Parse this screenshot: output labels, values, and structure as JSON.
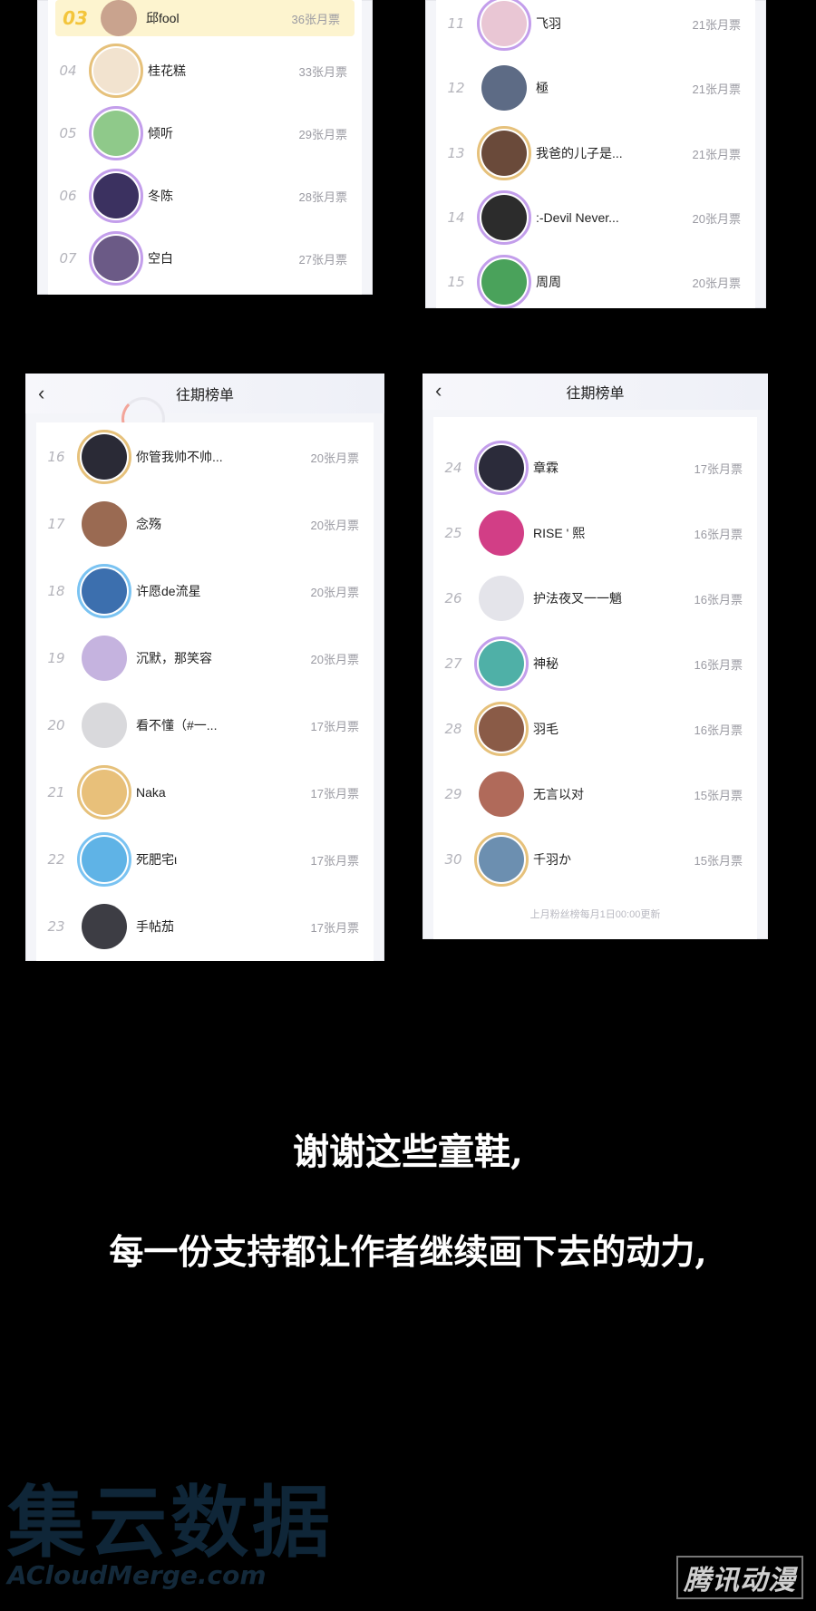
{
  "panels": {
    "top_left": {
      "rows": [
        {
          "rank": "03",
          "name": "邱fool",
          "votes": "36张月票",
          "highlight": true
        },
        {
          "rank": "04",
          "name": "桂花糕",
          "votes": "33张月票"
        },
        {
          "rank": "05",
          "name": "倾听",
          "votes": "29张月票"
        },
        {
          "rank": "06",
          "name": "冬陈",
          "votes": "28张月票"
        },
        {
          "rank": "07",
          "name": "空白",
          "votes": "27张月票"
        }
      ]
    },
    "top_right": {
      "rows": [
        {
          "rank": "11",
          "name": "飞羽",
          "votes": "21张月票"
        },
        {
          "rank": "12",
          "name": "極",
          "votes": "21张月票"
        },
        {
          "rank": "13",
          "name": "我爸的儿子是...",
          "votes": "21张月票"
        },
        {
          "rank": "14",
          "name": ":-Devil Never...",
          "votes": "20张月票"
        },
        {
          "rank": "15",
          "name": "周周",
          "votes": "20张月票"
        }
      ]
    },
    "bottom_left": {
      "title": "往期榜单",
      "back_icon": "‹",
      "rows": [
        {
          "rank": "16",
          "name": "你管我帅不帅...",
          "votes": "20张月票"
        },
        {
          "rank": "17",
          "name": "念殇",
          "votes": "20张月票"
        },
        {
          "rank": "18",
          "name": "许愿de流星",
          "votes": "20张月票"
        },
        {
          "rank": "19",
          "name": "沉默，那笑容",
          "votes": "20张月票"
        },
        {
          "rank": "20",
          "name": "看不懂（#一...",
          "votes": "17张月票"
        },
        {
          "rank": "21",
          "name": "Naka",
          "votes": "17张月票"
        },
        {
          "rank": "22",
          "name": "死肥宅ι",
          "votes": "17张月票"
        },
        {
          "rank": "23",
          "name": "手帖茄",
          "votes": "17张月票"
        }
      ]
    },
    "bottom_right": {
      "title": "往期榜单",
      "back_icon": "‹",
      "rows": [
        {
          "rank": "24",
          "name": "章霖",
          "votes": "17张月票"
        },
        {
          "rank": "25",
          "name": "RISE ' 熙",
          "votes": "16张月票"
        },
        {
          "rank": "26",
          "name": "护法夜叉一一魈",
          "votes": "16张月票"
        },
        {
          "rank": "27",
          "name": "神秘",
          "votes": "16张月票"
        },
        {
          "rank": "28",
          "name": "羽毛",
          "votes": "16张月票"
        },
        {
          "rank": "29",
          "name": "无言以对",
          "votes": "15张月票"
        },
        {
          "rank": "30",
          "name": "千羽か",
          "votes": "15张月票"
        }
      ],
      "footer": "上月粉丝榜每月1日00:00更新"
    }
  },
  "captions": {
    "line1": "谢谢这些童鞋,",
    "line2": "每一份支持都让作者继续画下去的动力,"
  },
  "watermark": {
    "cn": "集云数据",
    "en": "ACloudMerge.com"
  },
  "brand": "腾讯动漫",
  "colors": {
    "gold_rank": "#f3c53c",
    "highlight_bg": "#fdf4cf",
    "vote_text": "#9a9aa2"
  }
}
